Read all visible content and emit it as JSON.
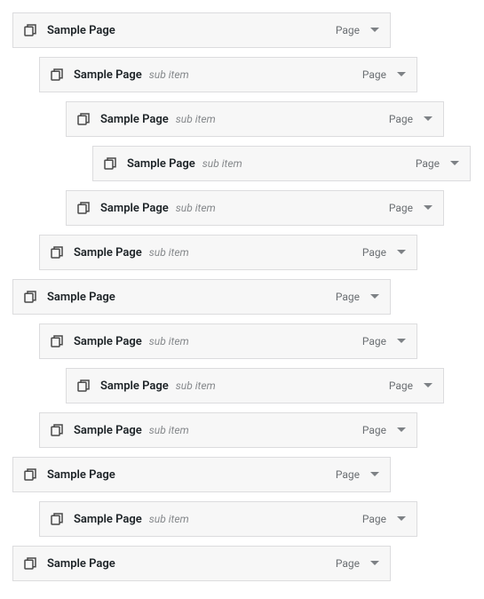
{
  "labels": {
    "sub_item": "sub item"
  },
  "item_type": "Page",
  "items": [
    {
      "title": "Sample Page",
      "depth": 0,
      "sub": false
    },
    {
      "title": "Sample Page",
      "depth": 1,
      "sub": true
    },
    {
      "title": "Sample Page",
      "depth": 2,
      "sub": true
    },
    {
      "title": "Sample Page",
      "depth": 3,
      "sub": true
    },
    {
      "title": "Sample Page",
      "depth": 2,
      "sub": true
    },
    {
      "title": "Sample Page",
      "depth": 1,
      "sub": true
    },
    {
      "title": "Sample Page",
      "depth": 0,
      "sub": false
    },
    {
      "title": "Sample Page",
      "depth": 1,
      "sub": true
    },
    {
      "title": "Sample Page",
      "depth": 2,
      "sub": true
    },
    {
      "title": "Sample Page",
      "depth": 1,
      "sub": true
    },
    {
      "title": "Sample Page",
      "depth": 0,
      "sub": false
    },
    {
      "title": "Sample Page",
      "depth": 1,
      "sub": true
    },
    {
      "title": "Sample Page",
      "depth": 0,
      "sub": false
    }
  ]
}
